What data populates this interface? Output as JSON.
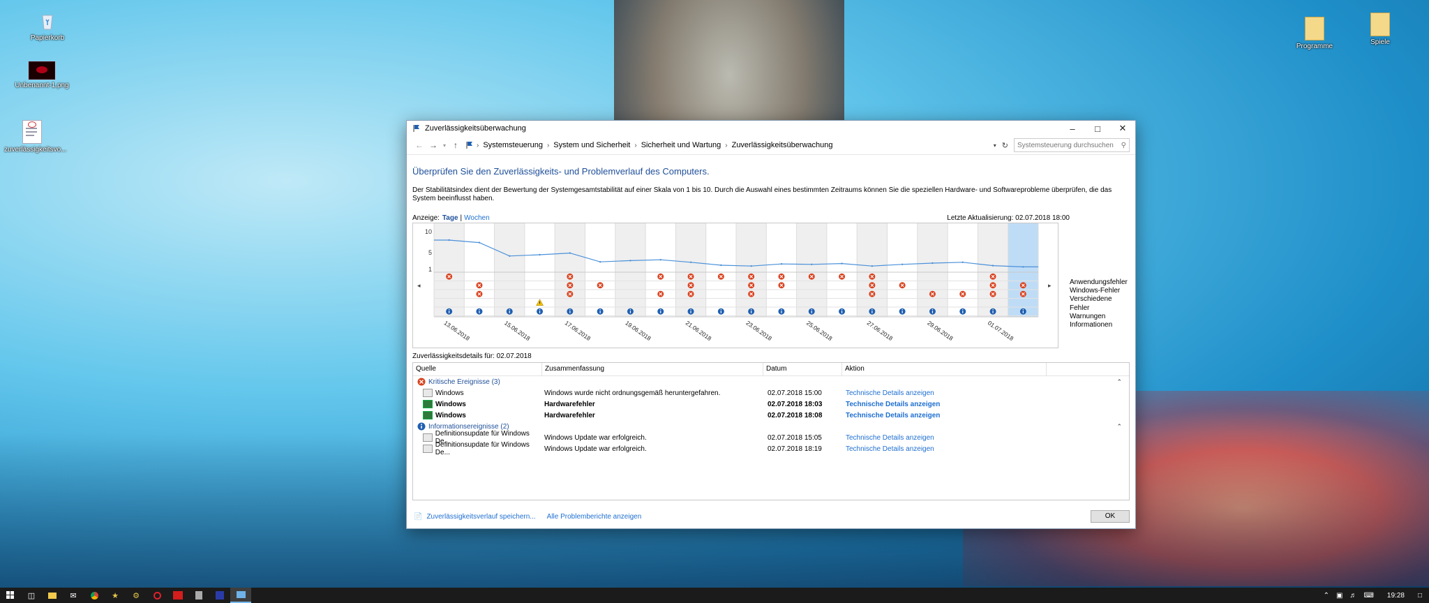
{
  "desktop": {
    "icons": [
      {
        "label": "Papierkorb",
        "icon": "recycle-bin-icon"
      },
      {
        "label": "Unbenannt-1.png",
        "icon": "image-file-icon"
      },
      {
        "label": "zuverlässigkeitsvo...",
        "icon": "document-file-icon"
      },
      {
        "label": "Programme",
        "icon": "folder-icon"
      },
      {
        "label": "Spiele",
        "icon": "folder-icon"
      }
    ]
  },
  "window": {
    "title": "Zuverlässigkeitsüberwachung",
    "breadcrumb": [
      "Systemsteuerung",
      "System und Sicherheit",
      "Sicherheit und Wartung",
      "Zuverlässigkeitsüberwachung"
    ],
    "search_placeholder": "Systemsteuerung durchsuchen",
    "heading": "Überprüfen Sie den Zuverlässigkeits- und Problemverlauf des Computers.",
    "description": "Der Stabilitätsindex dient der Bewertung der Systemgesamtstabilität auf einer Skala von 1 bis 10. Durch die Auswahl eines bestimmten Zeitraums können Sie die speziellen Hardware- und Softwareprobleme überprüfen, die das System beeinflusst haben.",
    "view_label": "Anzeige:",
    "view_days": "Tage",
    "view_sep": "|",
    "view_weeks": "Wochen",
    "last_update": "Letzte Aktualisierung: 02.07.2018 18:00",
    "details_for": "Zuverlässigkeitsdetails für: 02.07.2018",
    "columns": [
      "Quelle",
      "Zusammenfassung",
      "Datum",
      "Aktion"
    ],
    "groups": [
      {
        "label": "Kritische Ereignisse (3)",
        "icon": "error-icon",
        "rows": [
          {
            "source": "Windows",
            "summary": "Windows wurde nicht ordnungsgemäß heruntergefahren.",
            "date": "02.07.2018 15:00",
            "action": "Technische Details anzeigen",
            "bold": false,
            "icon": "event-icon"
          },
          {
            "source": "Windows",
            "summary": "Hardwarefehler",
            "date": "02.07.2018 18:03",
            "action": "Technische Details anzeigen",
            "bold": true,
            "icon": "hardware-icon"
          },
          {
            "source": "Windows",
            "summary": "Hardwarefehler",
            "date": "02.07.2018 18:08",
            "action": "Technische Details anzeigen",
            "bold": true,
            "icon": "hardware-icon"
          }
        ]
      },
      {
        "label": "Informationsereignisse (2)",
        "icon": "info-icon",
        "rows": [
          {
            "source": "Definitionsupdate für Windows De...",
            "summary": "Windows Update war erfolgreich.",
            "date": "02.07.2018 15:05",
            "action": "Technische Details anzeigen",
            "bold": false,
            "icon": "event-icon"
          },
          {
            "source": "Definitionsupdate für Windows De...",
            "summary": "Windows Update war erfolgreich.",
            "date": "02.07.2018 18:19",
            "action": "Technische Details anzeigen",
            "bold": false,
            "icon": "event-icon"
          }
        ]
      }
    ],
    "footer_save": "Zuverlässigkeitsverlauf speichern...",
    "footer_reports": "Alle Problemberichte anzeigen",
    "ok": "OK"
  },
  "chart_data": {
    "type": "line",
    "y_ticks": [
      "10",
      "5",
      "1"
    ],
    "ylim": [
      1,
      10
    ],
    "columns": 20,
    "selected_index": 19,
    "date_labels": [
      {
        "index": 0,
        "label": "13.06.2018"
      },
      {
        "index": 2,
        "label": "15.06.2018"
      },
      {
        "index": 4,
        "label": "17.06.2018"
      },
      {
        "index": 6,
        "label": "19.06.2018"
      },
      {
        "index": 8,
        "label": "21.06.2018"
      },
      {
        "index": 10,
        "label": "23.06.2018"
      },
      {
        "index": 12,
        "label": "25.06.2018"
      },
      {
        "index": 14,
        "label": "27.06.2018"
      },
      {
        "index": 16,
        "label": "29.06.2018"
      },
      {
        "index": 18,
        "label": "01.07.2018"
      }
    ],
    "stability_index": [
      8.0,
      7.4,
      4.2,
      4.5,
      4.9,
      2.8,
      3.1,
      3.3,
      2.7,
      2.0,
      1.8,
      2.3,
      2.2,
      2.4,
      1.8,
      2.2,
      2.5,
      2.7,
      1.9,
      1.6
    ],
    "legend": [
      "Anwendungsfehler",
      "Windows-Fehler",
      "Verschiedene Fehler",
      "Warnungen",
      "Informationen"
    ],
    "events": {
      "Anwendungsfehler": [
        0,
        4,
        7,
        8,
        9,
        10,
        11,
        12,
        13,
        14,
        18
      ],
      "Windows-Fehler": [
        1,
        4,
        5,
        8,
        10,
        11,
        14,
        15,
        18,
        19
      ],
      "Verschiedene Fehler": [
        1,
        4,
        7,
        8,
        10,
        14,
        16,
        17,
        18,
        19
      ],
      "Warnungen": [
        3
      ],
      "Informationen": [
        0,
        1,
        2,
        3,
        4,
        5,
        6,
        7,
        8,
        9,
        10,
        11,
        12,
        13,
        14,
        15,
        16,
        17,
        18,
        19
      ]
    },
    "colors": {
      "line": "#4a90d9",
      "error": "#d9421f",
      "warning": "#f2c200",
      "info": "#1f5fb0",
      "selected": "#bfdcf6",
      "shade": "#efefef"
    }
  },
  "taskbar": {
    "clock": "19:28"
  }
}
